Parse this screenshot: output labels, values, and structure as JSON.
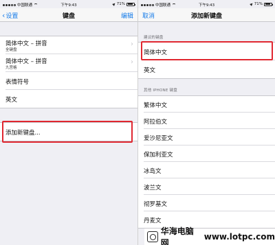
{
  "left_screen": {
    "status": {
      "carrier": "中国联通",
      "time": "下午9:43",
      "battery": "71%"
    },
    "nav": {
      "back_label": "设置",
      "title": "键盘",
      "right_label": "编辑"
    },
    "keyboards": [
      {
        "label": "简体中文 – 拼音",
        "sub": "全键盘"
      },
      {
        "label": "简体中文 – 拼音",
        "sub": "九宫格"
      },
      {
        "label": "表情符号",
        "sub": ""
      },
      {
        "label": "英文",
        "sub": ""
      }
    ],
    "add_keyboard_label": "添加新键盘..."
  },
  "right_screen": {
    "status": {
      "carrier": "中国联通",
      "time": "下午9:43",
      "battery": "71%"
    },
    "nav": {
      "left_label": "取消",
      "title": "添加新键盘"
    },
    "suggested_header": "建议的键盘",
    "suggested": [
      "简体中文",
      "英文"
    ],
    "other_header": "其他 IPHONE 键盘",
    "other": [
      "繁体中文",
      "阿拉伯文",
      "爱沙尼亚文",
      "保加利亚文",
      "冰岛文",
      "波兰文",
      "彻罗基文",
      "丹麦文"
    ]
  },
  "watermark": {
    "brand": "华海电脑网",
    "url": "www.lotpc.com"
  },
  "colors": {
    "accent": "#1a7ee9",
    "highlight": "#e0262f",
    "background": "#efeff4"
  }
}
